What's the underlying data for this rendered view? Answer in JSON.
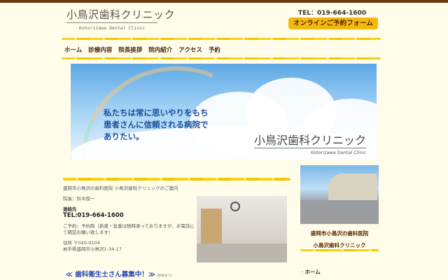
{
  "header": {
    "logo_jp": "小鳥沢歯科クリニック",
    "logo_en": "Kotorizawa Dental Clinic",
    "tel": "TEL：019-664-1600",
    "booking_button": "オンラインご予約フォーム"
  },
  "nav": [
    "ホーム",
    "診療内容",
    "院長挨拶",
    "院内紹介",
    "アクセス",
    "予約"
  ],
  "hero": {
    "message": [
      "私たちは常に思いやりをもち",
      "患者さんに信頼される病院で",
      "ありたい。"
    ],
    "logo_jp": "小鳥沢歯科クリニック",
    "logo_en": "Kotorizawa Dental Clinic"
  },
  "content": {
    "intro": "盛岡市小鳥沢の歯科医院 小鳥沢歯科クリニックのご案内",
    "director": "院長：鈴木俊一",
    "contact_label": "連絡先",
    "tel": "TEL:019-664-1600",
    "reservation": "ご予約：予約制（新患・急患は随時承っておりますが、お電話にて確認お願い致します）",
    "address_label": "住所 〒020-0104",
    "address": "岩手県盛岡市小鳥沢1-34-17",
    "recruit": "≪ 歯科衛生士さん募集中！≫",
    "recruit_note": "（鈴木まで）"
  },
  "sidebar": {
    "caption1": "盛岡市小鳥沢の歯科医院",
    "caption2": "小鳥沢歯科クリニック",
    "menu": [
      "ホーム"
    ]
  }
}
